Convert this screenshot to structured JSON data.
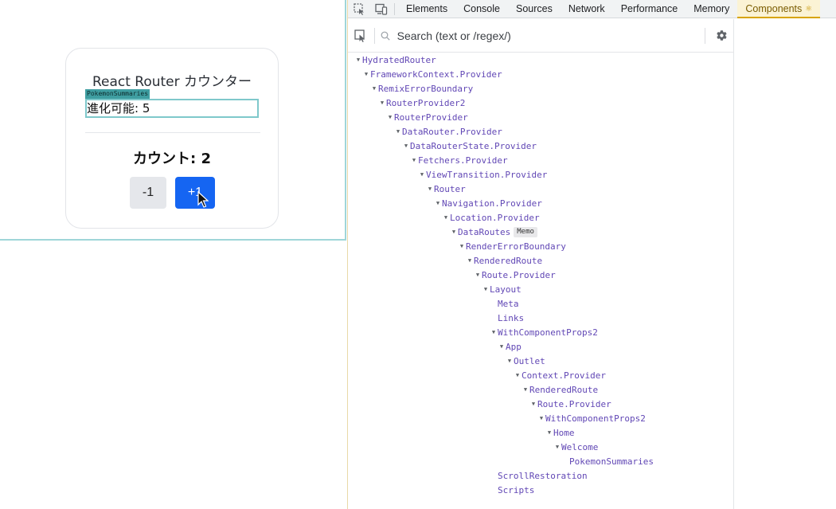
{
  "app": {
    "title": "React Router カウンター",
    "highlight_label": "PokemonSummaries",
    "summary_text": "進化可能: 5",
    "count_text": "カウント: 2",
    "decrement_label": "-1",
    "increment_label": "+1"
  },
  "devtools": {
    "tabs": [
      {
        "label": "Elements"
      },
      {
        "label": "Console"
      },
      {
        "label": "Sources"
      },
      {
        "label": "Network"
      },
      {
        "label": "Performance"
      },
      {
        "label": "Memory"
      },
      {
        "label": "Components"
      }
    ],
    "active_tab": "Components",
    "search_placeholder": "Search (text or /regex/)",
    "tree": [
      {
        "label": "HydratedRouter",
        "depth": 0,
        "expanded": true
      },
      {
        "label": "FrameworkContext.Provider",
        "depth": 1,
        "expanded": true
      },
      {
        "label": "RemixErrorBoundary",
        "depth": 2,
        "expanded": true
      },
      {
        "label": "RouterProvider2",
        "depth": 3,
        "expanded": true
      },
      {
        "label": "RouterProvider",
        "depth": 4,
        "expanded": true
      },
      {
        "label": "DataRouter.Provider",
        "depth": 5,
        "expanded": true
      },
      {
        "label": "DataRouterState.Provider",
        "depth": 6,
        "expanded": true
      },
      {
        "label": "Fetchers.Provider",
        "depth": 7,
        "expanded": true
      },
      {
        "label": "ViewTransition.Provider",
        "depth": 8,
        "expanded": true
      },
      {
        "label": "Router",
        "depth": 9,
        "expanded": true
      },
      {
        "label": "Navigation.Provider",
        "depth": 10,
        "expanded": true
      },
      {
        "label": "Location.Provider",
        "depth": 11,
        "expanded": true
      },
      {
        "label": "DataRoutes",
        "depth": 12,
        "expanded": true,
        "badge": "Memo"
      },
      {
        "label": "RenderErrorBoundary",
        "depth": 13,
        "expanded": true
      },
      {
        "label": "RenderedRoute",
        "depth": 14,
        "expanded": true
      },
      {
        "label": "Route.Provider",
        "depth": 15,
        "expanded": true
      },
      {
        "label": "Layout",
        "depth": 16,
        "expanded": true
      },
      {
        "label": "Meta",
        "depth": 17,
        "expanded": false
      },
      {
        "label": "Links",
        "depth": 17,
        "expanded": false
      },
      {
        "label": "WithComponentProps2",
        "depth": 17,
        "expanded": true
      },
      {
        "label": "App",
        "depth": 18,
        "expanded": true
      },
      {
        "label": "Outlet",
        "depth": 19,
        "expanded": true
      },
      {
        "label": "Context.Provider",
        "depth": 20,
        "expanded": true
      },
      {
        "label": "RenderedRoute",
        "depth": 21,
        "expanded": true
      },
      {
        "label": "Route.Provider",
        "depth": 22,
        "expanded": true
      },
      {
        "label": "WithComponentProps2",
        "depth": 23,
        "expanded": true
      },
      {
        "label": "Home",
        "depth": 24,
        "expanded": true
      },
      {
        "label": "Welcome",
        "depth": 25,
        "expanded": true
      },
      {
        "label": "PokemonSummaries",
        "depth": 26,
        "expanded": false
      },
      {
        "label": "ScrollRestoration",
        "depth": 17,
        "expanded": false
      },
      {
        "label": "Scripts",
        "depth": 17,
        "expanded": false
      }
    ]
  }
}
